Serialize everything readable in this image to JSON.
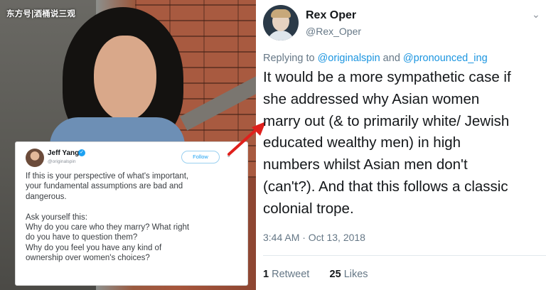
{
  "watermark": "东方号|酒桶说三观",
  "embedded_tweet": {
    "name": "Jeff Yang",
    "handle": "@originalspin",
    "follow_label": "Follow",
    "body_lines": [
      "If this is your perspective of what's important,",
      "your fundamental assumptions are bad and",
      "dangerous.",
      "",
      "Ask yourself this:",
      "Why do you care who they marry? What right",
      "do you have to question them?",
      "Why do you feel you have any kind of",
      "ownership over women's choices?"
    ]
  },
  "main_tweet": {
    "name": "Rex Oper",
    "handle": "@Rex_Oper",
    "reply_prefix": "Replying to ",
    "mention_1": "@originalspin",
    "reply_and": " and ",
    "mention_2": "@pronounced_ing",
    "text_lines": [
      "It would be a more sympathetic case if",
      "she addressed why Asian women",
      "marry out (& to primarily white/ Jewish",
      "educated wealthy men) in high",
      "numbers whilst Asian men don't",
      "(can't?). And that this follows a classic",
      "colonial trope."
    ],
    "timestamp": "3:44 AM · Oct 13, 2018",
    "retweets_count": "1",
    "retweets_label": "Retweet",
    "likes_count": "25",
    "likes_label": "Likes"
  },
  "colors": {
    "accent": "#1b95e0",
    "arrow": "#e0201c",
    "verified": "#1da1f2"
  },
  "icons": [
    "verified-icon",
    "chevron-down-icon",
    "red-arrow"
  ]
}
